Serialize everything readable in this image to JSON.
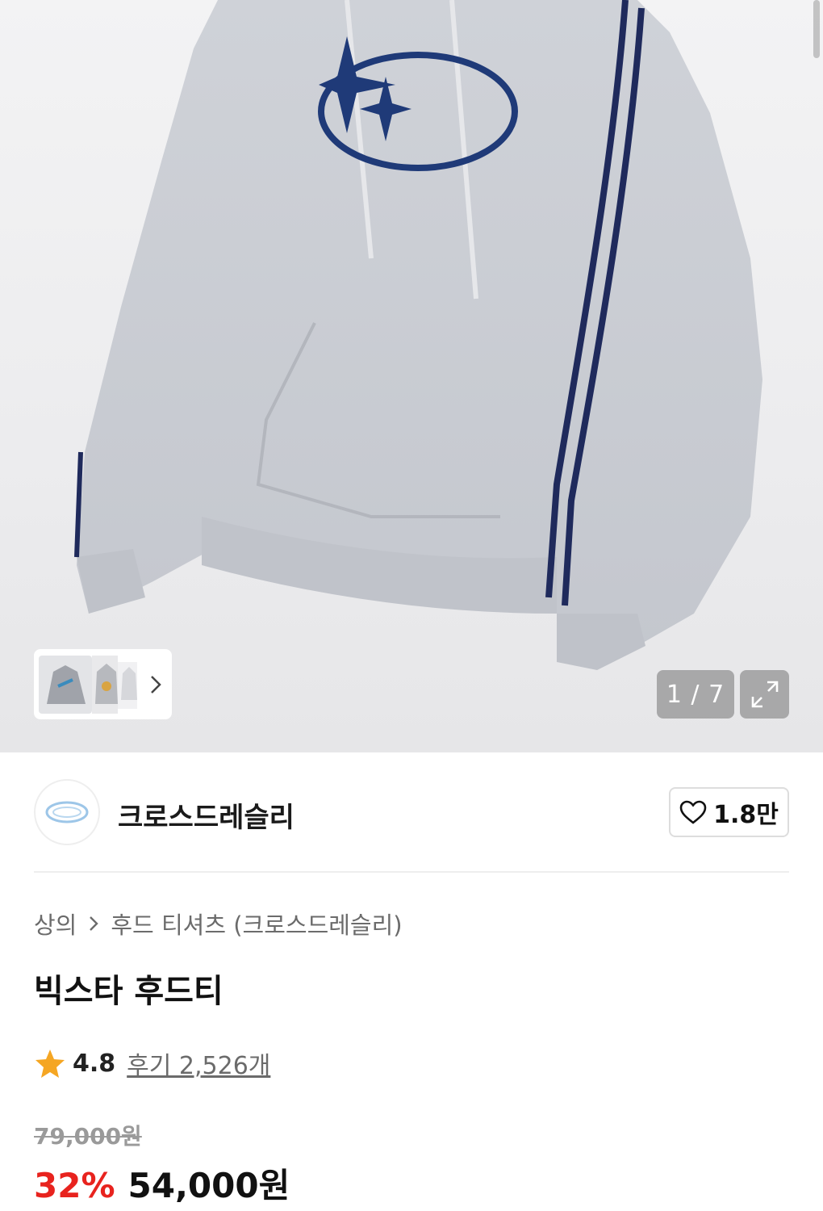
{
  "gallery": {
    "counter_current": "1",
    "counter_sep": " / ",
    "counter_total": "7",
    "counter_text": "1 / 7",
    "expand_icon": "expand-icon",
    "next_icon": "chevron-right-icon"
  },
  "brand": {
    "name": "크로스드레슬리",
    "likes": "1.8만",
    "like_icon": "heart-outline-icon"
  },
  "breadcrumb": {
    "level1": "상의",
    "separator_icon": "chevron-right-icon",
    "level2": "후드 티셔츠 (크로스드레슬리)"
  },
  "product": {
    "title": "빅스타 후드티",
    "rating": "4.8",
    "reviews": "후기 2,526개",
    "original_price": "79,000원",
    "discount": "32%",
    "price": "54,000원"
  },
  "colors": {
    "discount": "#e8231e",
    "star": "#f5a623",
    "hoodie": "#c9ccd3",
    "stripe": "#1f2a5c"
  }
}
